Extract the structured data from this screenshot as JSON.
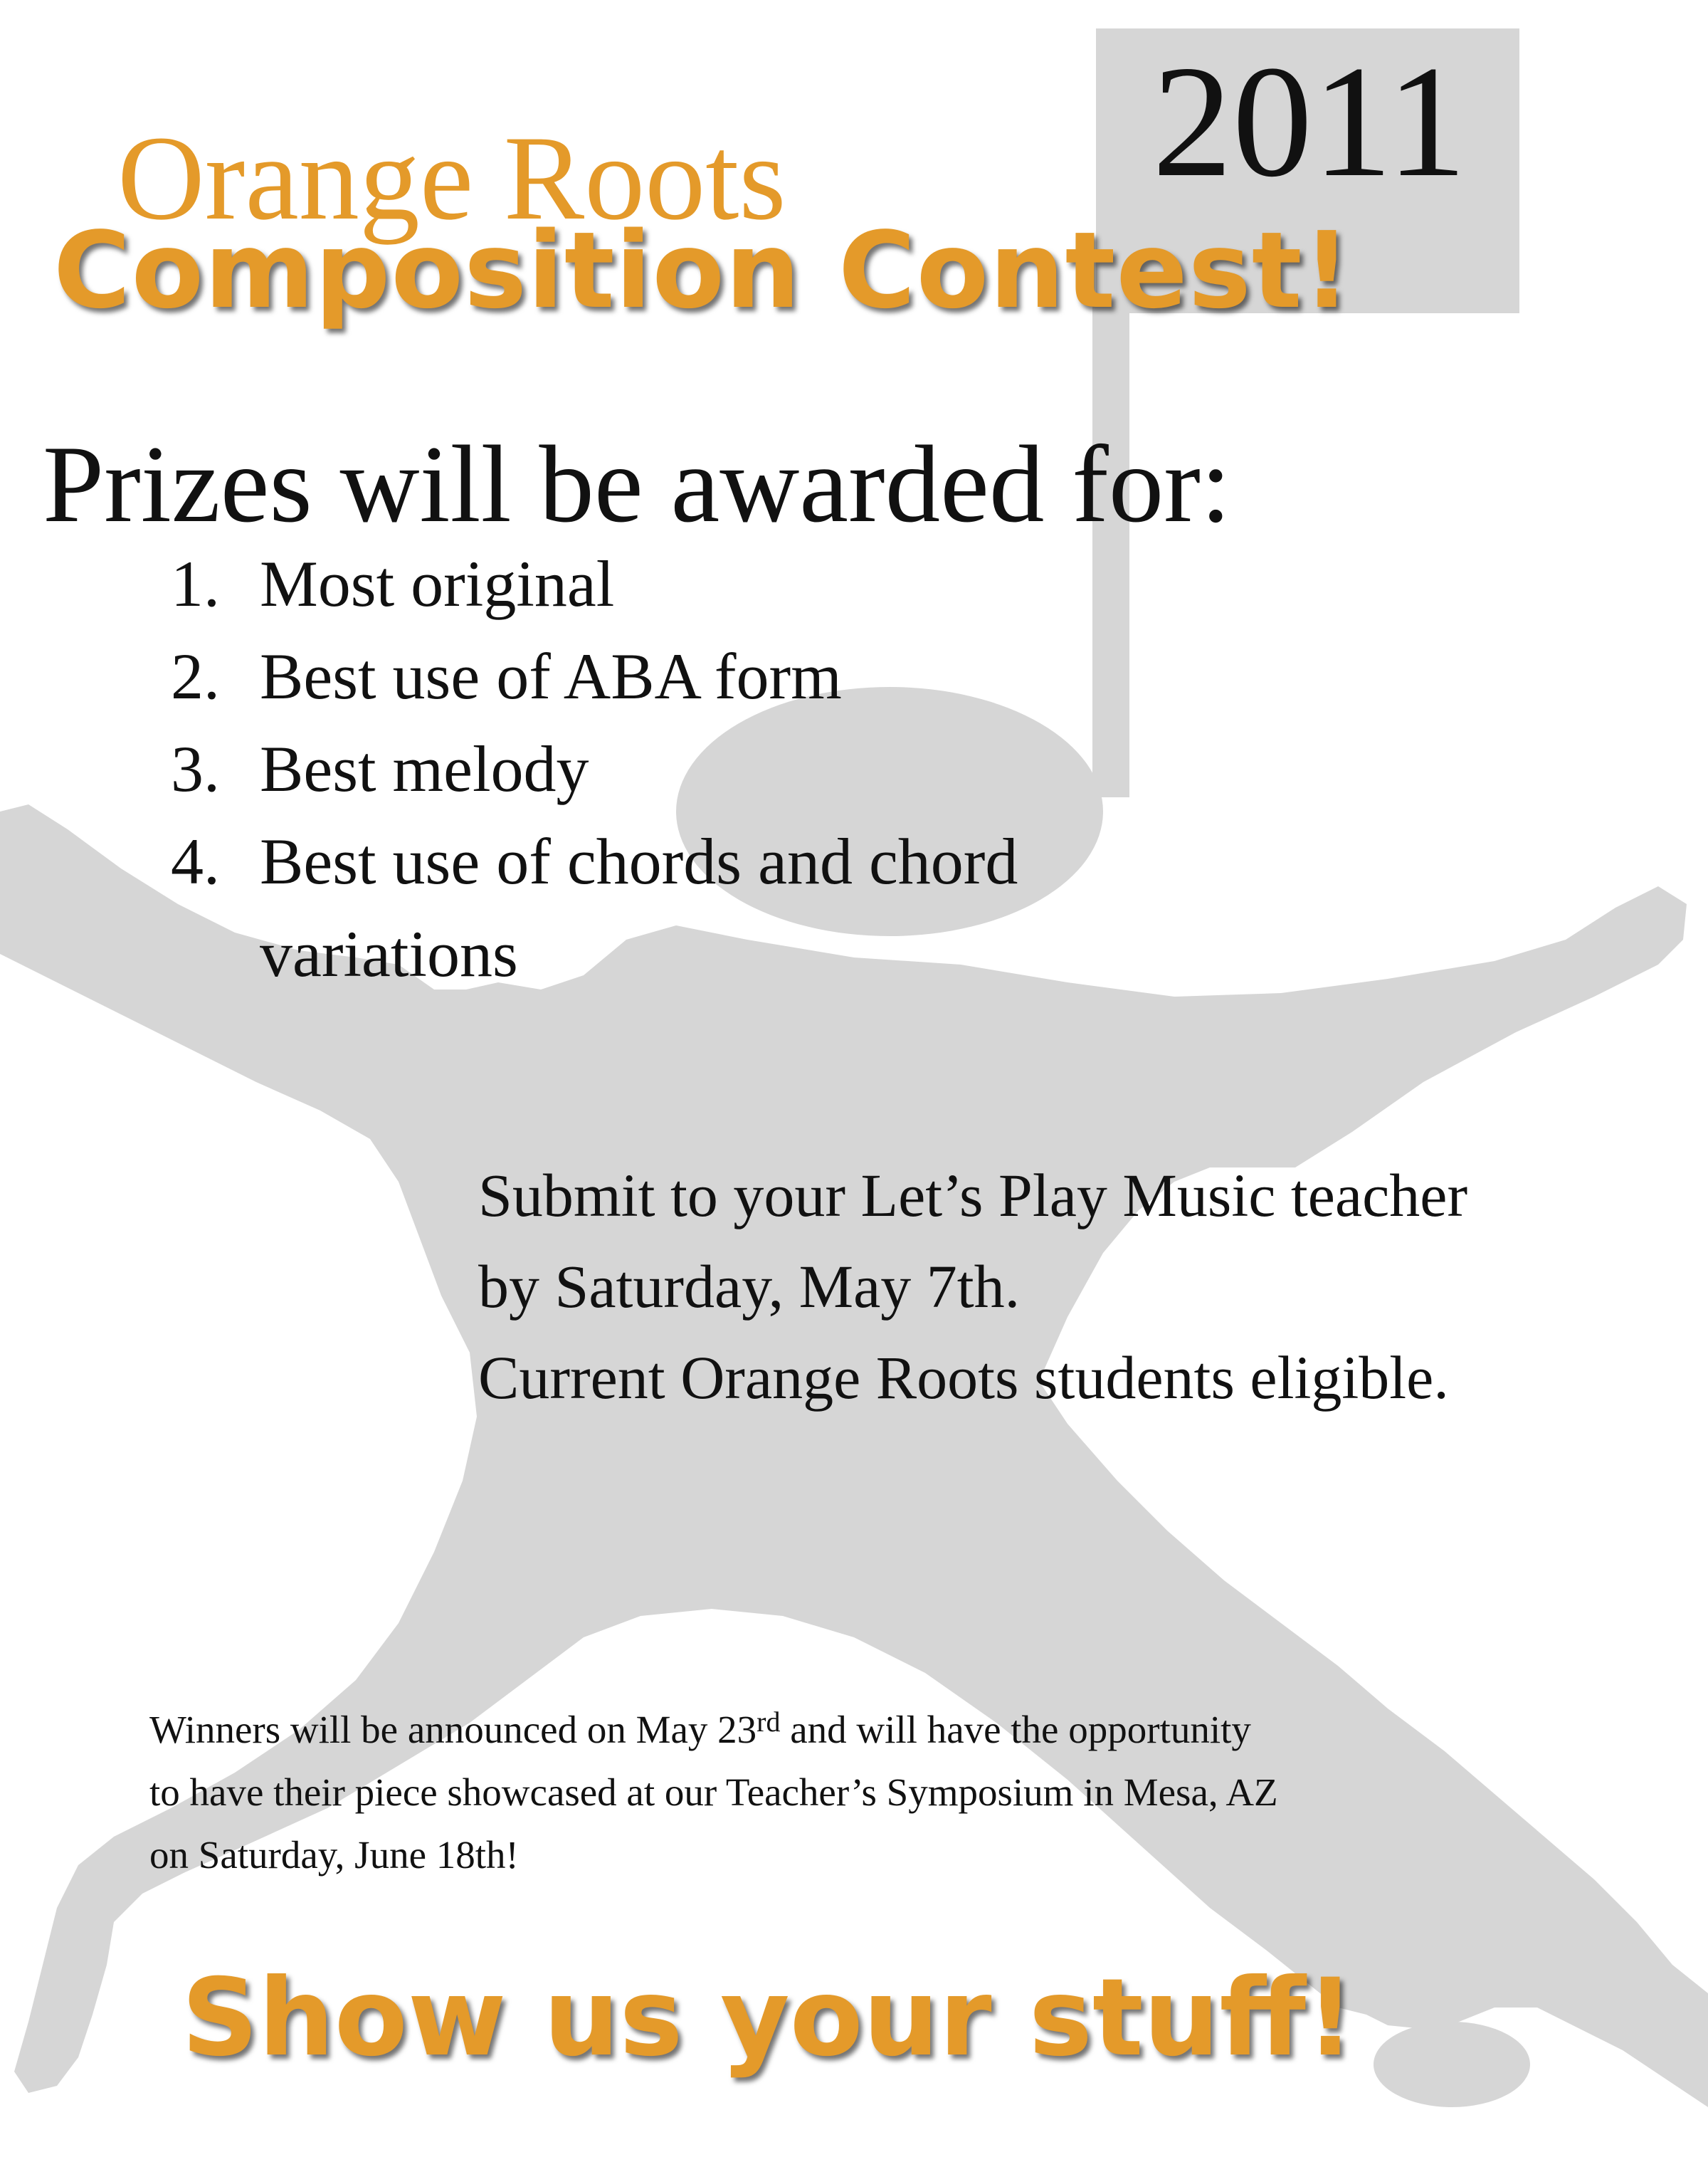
{
  "colors": {
    "accent": "#e49a2a",
    "text": "#111111",
    "silhouette": "#d6d6d6"
  },
  "icons": {
    "music_note": "music-note-icon",
    "dancer": "jumping-dancer-silhouette"
  },
  "header": {
    "year": "2011",
    "brand": "Orange Roots",
    "title": "Composition Contest!"
  },
  "prizes": {
    "heading": "Prizes will be awarded for:",
    "items": [
      {
        "num": "1.",
        "text": "Most original"
      },
      {
        "num": "2.",
        "text": "Best use of ABA form"
      },
      {
        "num": "3.",
        "text": "Best melody"
      },
      {
        "num": "4.",
        "text": "Best use of chords and chord variations"
      }
    ]
  },
  "submit": {
    "line1": "Submit to your Let’s Play Music teacher",
    "line2": "by Saturday, May 7th.",
    "line3": "Current Orange Roots students eligible."
  },
  "winners": {
    "line1_before": "Winners will be announced on May 23",
    "line1_sup": "rd",
    "line1_after": " and will have the opportunity",
    "line2": "to have their piece showcased at our Teacher’s Symposium in Mesa, AZ",
    "line3": "on Saturday, June 18th!"
  },
  "footer": {
    "tagline": "Show us your stuff!"
  }
}
